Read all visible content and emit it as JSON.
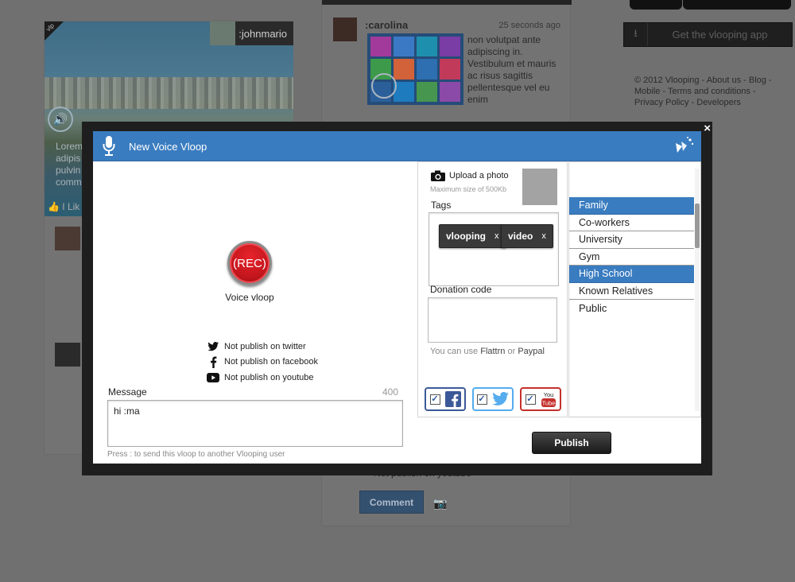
{
  "background": {
    "left_post": {
      "username": ":johnmario",
      "tag_label": "vlp",
      "body_lines": [
        "Lorem",
        "adipis",
        "pulvin",
        "comm"
      ],
      "like_text": "I Lik"
    },
    "mid_post": {
      "username": ":carolina",
      "time": "25 seconds ago",
      "body": "non volutpat ante adipiscing in. Vestibulum et mauris ac risus sagittis pellentesque vel eu enim",
      "partial_social_note": "Not publish on youtube",
      "comment_label": "Comment"
    },
    "get_app_label": "Get the vlooping app",
    "footer": {
      "copyright": "© 2012 Vlooping",
      "links": [
        "About us",
        "Blog",
        "Mobile",
        "Terms and conditions",
        "Privacy Policy",
        "Developers"
      ]
    }
  },
  "modal": {
    "close_label": "×",
    "title": "New Voice Vloop",
    "rec_button_label": "(REC)",
    "rec_caption": "Voice vloop",
    "social_options": [
      {
        "icon": "twitter-icon",
        "label": "Not publish on twitter"
      },
      {
        "icon": "facebook-icon",
        "label": "Not publish on facebook"
      },
      {
        "icon": "youtube-icon",
        "label": "Not publish on youtube"
      }
    ],
    "message": {
      "label": "Message",
      "char_count": "400",
      "value": "hi :ma",
      "hint": "Press : to send this vloop to another Vlooping user"
    },
    "upload": {
      "label": "Upload a photo",
      "sublabel": "Maximum size of 500Kb"
    },
    "tags": {
      "label": "Tags",
      "items": [
        {
          "text": "vlooping",
          "remove": "x"
        },
        {
          "text": "video",
          "remove": "x"
        }
      ]
    },
    "donation": {
      "label": "Donation code",
      "value": "",
      "hint_prefix": "You can use",
      "hint_flattr": "Flattrn",
      "hint_or": "or",
      "hint_paypal": "Paypal"
    },
    "share_buttons": [
      {
        "name": "facebook",
        "checked": true,
        "color": "#3b5998"
      },
      {
        "name": "twitter",
        "checked": true,
        "color": "#55acee"
      },
      {
        "name": "youtube",
        "checked": true,
        "color": "#c4302b"
      }
    ],
    "groups": [
      {
        "label": "Family",
        "selected": true
      },
      {
        "label": "Co-workers",
        "selected": false
      },
      {
        "label": "University",
        "selected": false
      },
      {
        "label": "Gym",
        "selected": false
      },
      {
        "label": "High School",
        "selected": true
      },
      {
        "label": "Known Relatives",
        "selected": false
      },
      {
        "label": "Public",
        "selected": false
      }
    ],
    "publish_label": "Publish",
    "colors": {
      "header_blue": "#3a7cc0",
      "rec_red": "#c4161d",
      "overlay": "#707070"
    }
  }
}
